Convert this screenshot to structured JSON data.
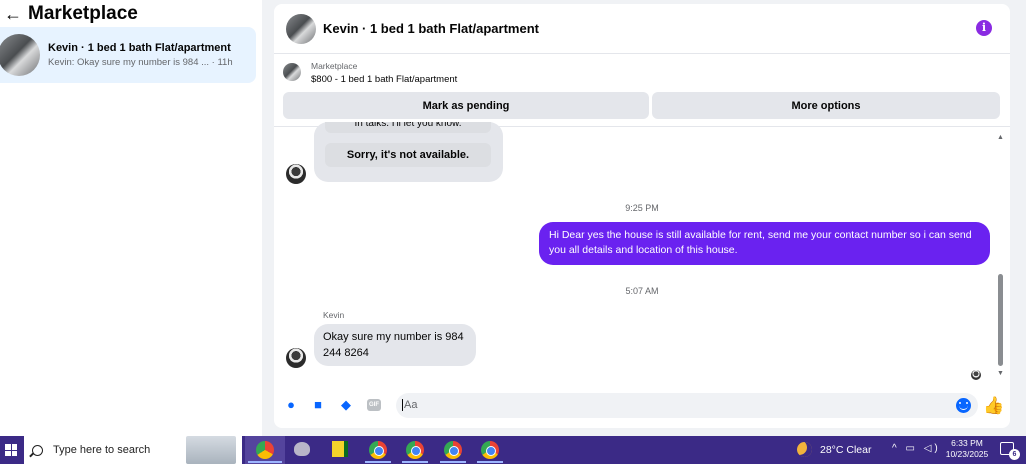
{
  "left_panel": {
    "title": "Marketplace",
    "conversation": {
      "title": "Kevin · 1 bed 1 bath Flat/apartment",
      "preview": "Kevin: Okay sure my number is 984 ... · 11h"
    }
  },
  "chat": {
    "header_title": "Kevin · 1 bed 1 bath Flat/apartment",
    "info_icon_glyph": "i",
    "marketplace_label": "Marketplace",
    "listing": "$800 - 1 bed 1 bath Flat/apartment",
    "mark_pending_label": "Mark as pending",
    "more_options_label": "More options",
    "partial_message": "In talks. I'll let you know.",
    "earlier_reply": "Sorry, it's not available.",
    "timestamp_1": "9:25 PM",
    "sent_message": "Hi Dear yes the house is still available for rent, send me your contact number so i can send you all details and location of this house.",
    "timestamp_2": "5:07 AM",
    "sender_name": "Kevin",
    "received_message": "Okay sure my number is 984 244 8264",
    "composer_placeholder": "Aa",
    "gif_label": "GIF",
    "accent_color": "#6a22f0",
    "messenger_blue": "#0866ff"
  },
  "taskbar": {
    "search_placeholder": "Type here to search",
    "weather": "28°C  Clear",
    "time": "6:33 PM",
    "date": "10/23/2025",
    "notification_count": "6",
    "color": "#3b2a86"
  }
}
